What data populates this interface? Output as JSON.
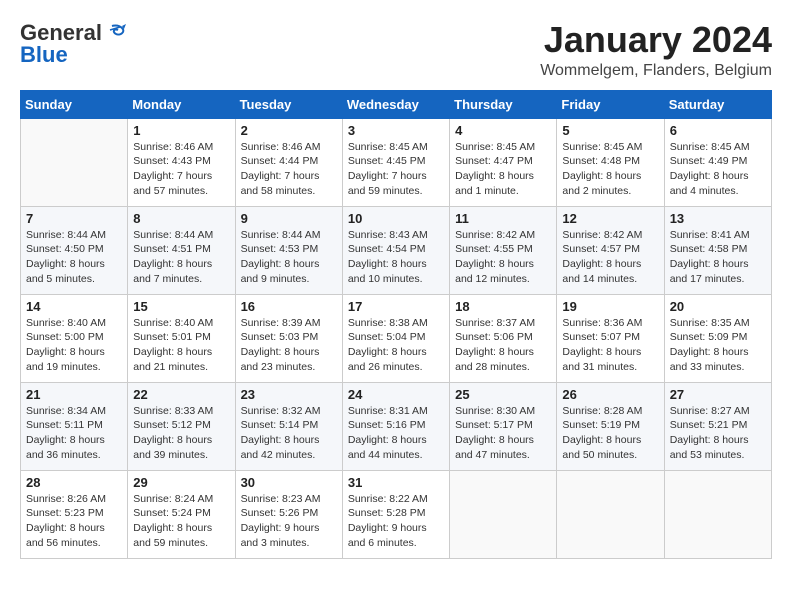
{
  "header": {
    "logo_general": "General",
    "logo_blue": "Blue",
    "month_title": "January 2024",
    "location": "Wommelgem, Flanders, Belgium"
  },
  "days_of_week": [
    "Sunday",
    "Monday",
    "Tuesday",
    "Wednesday",
    "Thursday",
    "Friday",
    "Saturday"
  ],
  "weeks": [
    [
      {
        "day": "",
        "info": ""
      },
      {
        "day": "1",
        "info": "Sunrise: 8:46 AM\nSunset: 4:43 PM\nDaylight: 7 hours\nand 57 minutes."
      },
      {
        "day": "2",
        "info": "Sunrise: 8:46 AM\nSunset: 4:44 PM\nDaylight: 7 hours\nand 58 minutes."
      },
      {
        "day": "3",
        "info": "Sunrise: 8:45 AM\nSunset: 4:45 PM\nDaylight: 7 hours\nand 59 minutes."
      },
      {
        "day": "4",
        "info": "Sunrise: 8:45 AM\nSunset: 4:47 PM\nDaylight: 8 hours\nand 1 minute."
      },
      {
        "day": "5",
        "info": "Sunrise: 8:45 AM\nSunset: 4:48 PM\nDaylight: 8 hours\nand 2 minutes."
      },
      {
        "day": "6",
        "info": "Sunrise: 8:45 AM\nSunset: 4:49 PM\nDaylight: 8 hours\nand 4 minutes."
      }
    ],
    [
      {
        "day": "7",
        "info": "Sunrise: 8:44 AM\nSunset: 4:50 PM\nDaylight: 8 hours\nand 5 minutes."
      },
      {
        "day": "8",
        "info": "Sunrise: 8:44 AM\nSunset: 4:51 PM\nDaylight: 8 hours\nand 7 minutes."
      },
      {
        "day": "9",
        "info": "Sunrise: 8:44 AM\nSunset: 4:53 PM\nDaylight: 8 hours\nand 9 minutes."
      },
      {
        "day": "10",
        "info": "Sunrise: 8:43 AM\nSunset: 4:54 PM\nDaylight: 8 hours\nand 10 minutes."
      },
      {
        "day": "11",
        "info": "Sunrise: 8:42 AM\nSunset: 4:55 PM\nDaylight: 8 hours\nand 12 minutes."
      },
      {
        "day": "12",
        "info": "Sunrise: 8:42 AM\nSunset: 4:57 PM\nDaylight: 8 hours\nand 14 minutes."
      },
      {
        "day": "13",
        "info": "Sunrise: 8:41 AM\nSunset: 4:58 PM\nDaylight: 8 hours\nand 17 minutes."
      }
    ],
    [
      {
        "day": "14",
        "info": "Sunrise: 8:40 AM\nSunset: 5:00 PM\nDaylight: 8 hours\nand 19 minutes."
      },
      {
        "day": "15",
        "info": "Sunrise: 8:40 AM\nSunset: 5:01 PM\nDaylight: 8 hours\nand 21 minutes."
      },
      {
        "day": "16",
        "info": "Sunrise: 8:39 AM\nSunset: 5:03 PM\nDaylight: 8 hours\nand 23 minutes."
      },
      {
        "day": "17",
        "info": "Sunrise: 8:38 AM\nSunset: 5:04 PM\nDaylight: 8 hours\nand 26 minutes."
      },
      {
        "day": "18",
        "info": "Sunrise: 8:37 AM\nSunset: 5:06 PM\nDaylight: 8 hours\nand 28 minutes."
      },
      {
        "day": "19",
        "info": "Sunrise: 8:36 AM\nSunset: 5:07 PM\nDaylight: 8 hours\nand 31 minutes."
      },
      {
        "day": "20",
        "info": "Sunrise: 8:35 AM\nSunset: 5:09 PM\nDaylight: 8 hours\nand 33 minutes."
      }
    ],
    [
      {
        "day": "21",
        "info": "Sunrise: 8:34 AM\nSunset: 5:11 PM\nDaylight: 8 hours\nand 36 minutes."
      },
      {
        "day": "22",
        "info": "Sunrise: 8:33 AM\nSunset: 5:12 PM\nDaylight: 8 hours\nand 39 minutes."
      },
      {
        "day": "23",
        "info": "Sunrise: 8:32 AM\nSunset: 5:14 PM\nDaylight: 8 hours\nand 42 minutes."
      },
      {
        "day": "24",
        "info": "Sunrise: 8:31 AM\nSunset: 5:16 PM\nDaylight: 8 hours\nand 44 minutes."
      },
      {
        "day": "25",
        "info": "Sunrise: 8:30 AM\nSunset: 5:17 PM\nDaylight: 8 hours\nand 47 minutes."
      },
      {
        "day": "26",
        "info": "Sunrise: 8:28 AM\nSunset: 5:19 PM\nDaylight: 8 hours\nand 50 minutes."
      },
      {
        "day": "27",
        "info": "Sunrise: 8:27 AM\nSunset: 5:21 PM\nDaylight: 8 hours\nand 53 minutes."
      }
    ],
    [
      {
        "day": "28",
        "info": "Sunrise: 8:26 AM\nSunset: 5:23 PM\nDaylight: 8 hours\nand 56 minutes."
      },
      {
        "day": "29",
        "info": "Sunrise: 8:24 AM\nSunset: 5:24 PM\nDaylight: 8 hours\nand 59 minutes."
      },
      {
        "day": "30",
        "info": "Sunrise: 8:23 AM\nSunset: 5:26 PM\nDaylight: 9 hours\nand 3 minutes."
      },
      {
        "day": "31",
        "info": "Sunrise: 8:22 AM\nSunset: 5:28 PM\nDaylight: 9 hours\nand 6 minutes."
      },
      {
        "day": "",
        "info": ""
      },
      {
        "day": "",
        "info": ""
      },
      {
        "day": "",
        "info": ""
      }
    ]
  ]
}
